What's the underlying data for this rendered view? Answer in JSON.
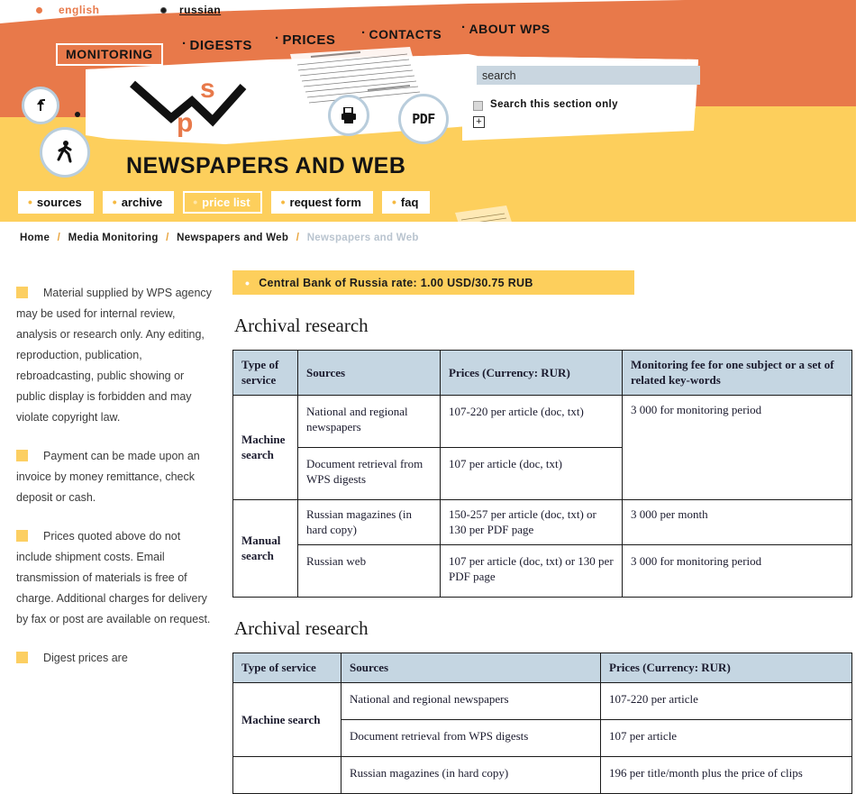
{
  "header": {
    "languages": [
      {
        "label": "english",
        "active": true
      },
      {
        "label": "russian",
        "active": false
      }
    ],
    "topnav": [
      {
        "label": "MONITORING",
        "active": true
      },
      {
        "label": "DIGESTS",
        "active": false
      },
      {
        "label": "PRICES",
        "active": false
      },
      {
        "label": "CONTACTS",
        "active": false
      },
      {
        "label": "ABOUT WPS",
        "active": false
      }
    ],
    "logo_letters": {
      "w": "W",
      "s": "s",
      "p": "p"
    },
    "icons": {
      "back": "back-arrow-icon",
      "walk": "pedestrian-icon",
      "print": "printer-icon",
      "pdf": "PDF"
    },
    "page_title": "NEWSPAPERS AND WEB",
    "subnav": [
      {
        "label": "sources",
        "active": false
      },
      {
        "label": "archive",
        "active": false
      },
      {
        "label": "price list",
        "active": true
      },
      {
        "label": "request form",
        "active": false
      },
      {
        "label": "faq",
        "active": false
      }
    ]
  },
  "search": {
    "value": "search",
    "placeholder": "search",
    "checkbox_label": "Search this section only",
    "checkbox_checked": false,
    "expand_glyph": "+"
  },
  "breadcrumb": [
    {
      "label": "Home",
      "current": false
    },
    {
      "label": "Media Monitoring",
      "current": false
    },
    {
      "label": "Newspapers and Web",
      "current": false
    },
    {
      "label": "Newspapers and Web",
      "current": true
    }
  ],
  "breadcrumb_separator": "/",
  "rate_banner": {
    "text": "Central Bank of Russia rate: 1.00 USD/30.75 RUB"
  },
  "notes": [
    "Material supplied by WPS agency may be used for internal review, analysis or research only. Any editing, reproduction, publication, rebroadcasting, public showing or public display is forbidden and may violate copyright law.",
    "Payment can be made upon an invoice by money remittance, check deposit or cash.",
    "Prices quoted above do not include shipment costs. Email transmission of materials is free of charge. Additional charges for delivery by fax or post are available on request.",
    "Digest prices are"
  ],
  "table1": {
    "title": "Archival research",
    "headers": [
      "Type of service",
      "Sources",
      "Prices (Currency: RUR)",
      "Monitoring fee for one subject or a set of related key-words"
    ],
    "rows": [
      {
        "service": "Machine search",
        "source": "National and regional newspapers",
        "price": "107-220 per article (doc, txt)",
        "fee": "3 000 for monitoring period"
      },
      {
        "service": "",
        "source": "Document retrieval from WPS digests",
        "price": "107 per article (doc, txt)",
        "fee": ""
      },
      {
        "service": "Manual search",
        "source": "Russian magazines (in hard copy)",
        "price": "150-257 per article (doc, txt) or 130 per PDF page",
        "fee": "3 000 per month"
      },
      {
        "service": "",
        "source": "Russian web",
        "price": "107 per article (doc, txt) or 130 per PDF page",
        "fee": "3 000 for monitoring period"
      }
    ]
  },
  "table2": {
    "title": "Archival research",
    "headers": [
      "Type of service",
      "Sources",
      "Prices (Currency: RUR)"
    ],
    "rows": [
      {
        "service": "Machine search",
        "source": "National and regional newspapers",
        "price": "107-220 per article"
      },
      {
        "service": "",
        "source": "Document retrieval from WPS digests",
        "price": "107 per article"
      },
      {
        "service": "",
        "source": "Russian magazines (in hard copy)",
        "price": "196 per title/month plus the price of clips"
      }
    ]
  },
  "colors": {
    "orange": "#e8794a",
    "yellow": "#fdcf5c",
    "table_header": "#c5d6e2",
    "note_square": "#fccf62",
    "search_field": "#c9d6e0"
  }
}
